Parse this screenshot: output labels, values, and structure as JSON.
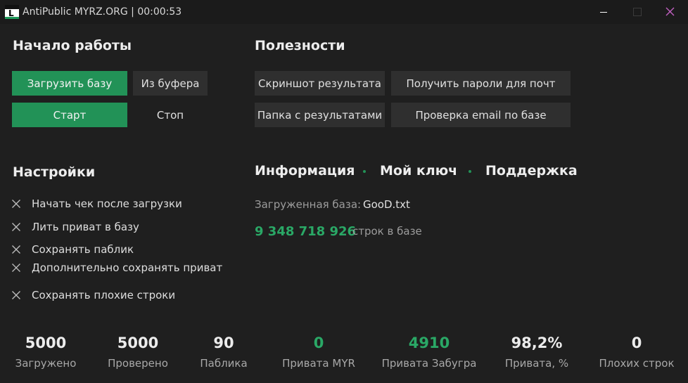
{
  "window": {
    "title": "AntiPublic MYRZ.ORG | 00:00:53",
    "icon_letter": "L"
  },
  "colors": {
    "accent_green": "#229257",
    "value_green": "#2aa866",
    "background": "#1f1f1f",
    "button_dark": "#2f2f2f",
    "close_icon": "#c060c0"
  },
  "start": {
    "title": "Начало работы",
    "load_db_label": "Загрузить базу",
    "from_buffer_label": "Из буфера",
    "start_label": "Старт",
    "stop_label": "Стоп"
  },
  "tools": {
    "title": "Полезности",
    "screenshot_label": "Скриншот результата",
    "get_passwords_label": "Получить пароли для почт",
    "results_folder_label": "Папка с результатами",
    "check_email_label": "Проверка email по базе"
  },
  "settings": {
    "title": "Настройки",
    "items": [
      {
        "label": "Начать чек после загрузки",
        "icon": "x-icon"
      },
      {
        "label": "Лить приват в базу",
        "icon": "x-icon"
      },
      {
        "label": "Сохранять паблик",
        "icon": "x-icon"
      },
      {
        "label": "Дополнительно сохранять приват",
        "icon": "x-icon"
      },
      {
        "label": "Сохранять плохие строки",
        "icon": "x-icon"
      }
    ]
  },
  "info": {
    "nav": [
      "Информация",
      "Мой ключ",
      "Поддержка"
    ],
    "loaded_db_label": "Загруженная база:",
    "loaded_db_value": "GooD.txt",
    "row_count": "9 348 718 926",
    "row_count_label": "строк в базе"
  },
  "stats": [
    {
      "value": "5000",
      "label": "Загружено",
      "green": false
    },
    {
      "value": "5000",
      "label": "Проверено",
      "green": false
    },
    {
      "value": "90",
      "label": "Паблика",
      "green": false
    },
    {
      "value": "0",
      "label": "Привата MYR",
      "green": true
    },
    {
      "value": "4910",
      "label": "Привата Забугра",
      "green": true
    },
    {
      "value": "98,2%",
      "label": "Привата, %",
      "green": false
    },
    {
      "value": "0",
      "label": "Плохих строк",
      "green": false
    }
  ]
}
